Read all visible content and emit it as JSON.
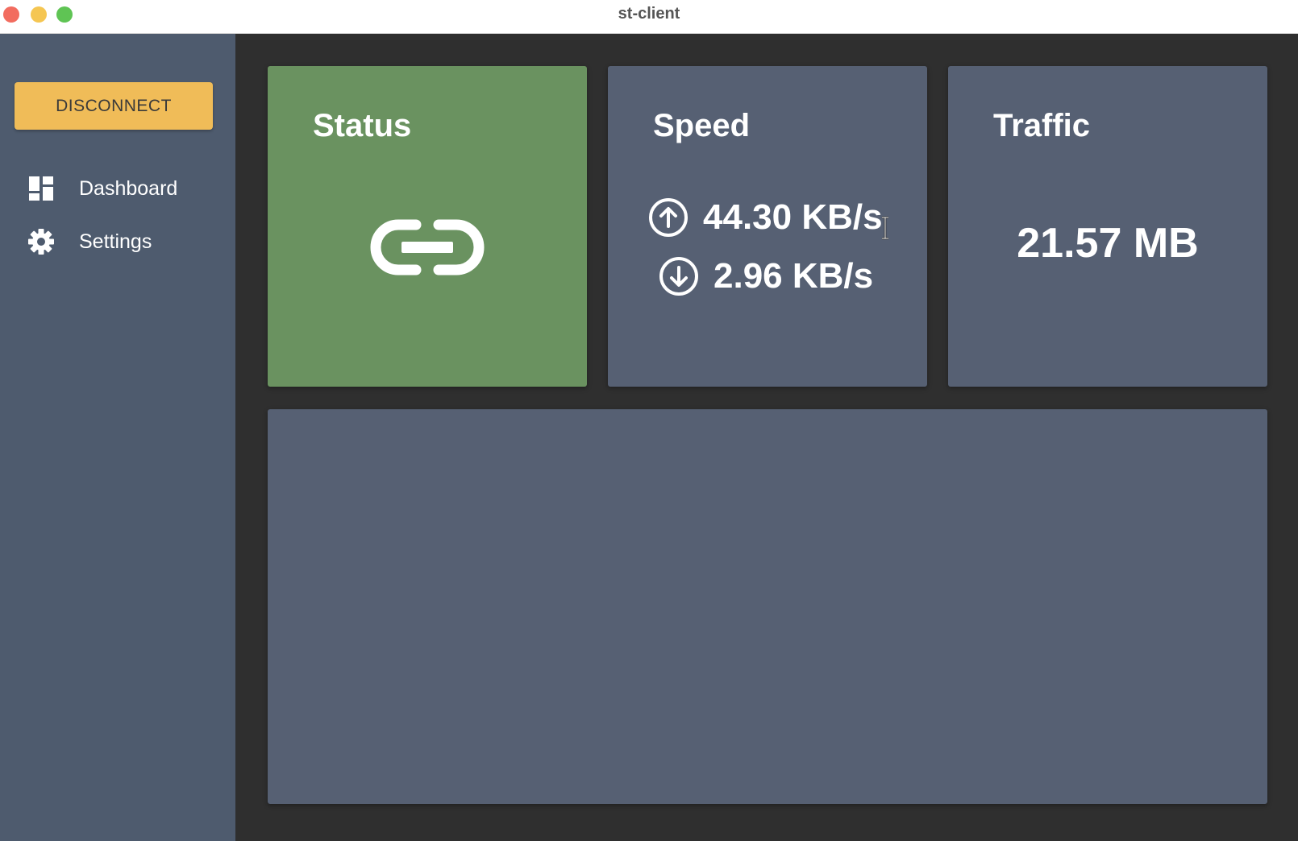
{
  "window": {
    "title": "st-client"
  },
  "sidebar": {
    "disconnect_label": "DISCONNECT",
    "items": [
      {
        "label": "Dashboard",
        "icon": "dashboard-icon"
      },
      {
        "label": "Settings",
        "icon": "gear-icon"
      }
    ]
  },
  "cards": {
    "status": {
      "title": "Status",
      "icon": "link-icon"
    },
    "speed": {
      "title": "Speed",
      "upload": "44.30 KB/s",
      "download": "2.96 KB/s"
    },
    "traffic": {
      "title": "Traffic",
      "value": "21.57 MB"
    }
  },
  "colors": {
    "sidebar_bg": "#4e5b6e",
    "main_bg": "#2f2f2f",
    "card_bg": "#566073",
    "status_connected": "#6a9260",
    "accent_button": "#f0bc58"
  }
}
